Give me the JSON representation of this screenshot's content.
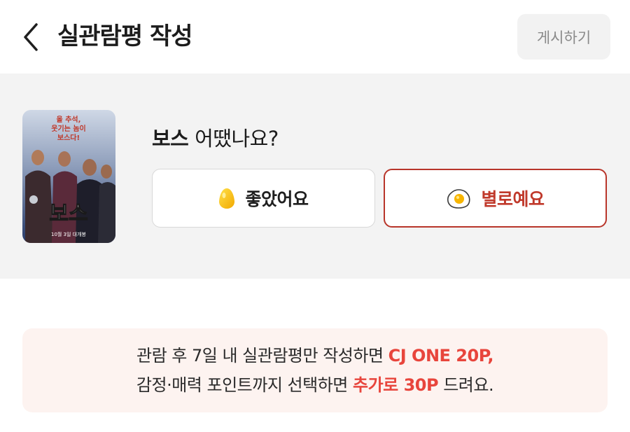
{
  "header": {
    "title": "실관람평 작성",
    "post_label": "게시하기"
  },
  "movie": {
    "title": "보스",
    "question_suffix": " 어땠나요?",
    "poster": {
      "tagline_line1": "올 추석,",
      "tagline_line2": "웃기는 놈이",
      "tagline_line3": "보스다!",
      "title": "보스",
      "release": "10월 3일 대개봉"
    }
  },
  "choices": {
    "good_label": "좋았어요",
    "bad_label": "별로예요",
    "selected": "bad"
  },
  "info": {
    "line1_text": "관람 후 7일 내 실관람평만 작성하면 ",
    "line1_highlight": "CJ ONE 20P,",
    "line2_text": "감정·매력 포인트까지 선택하면 ",
    "line2_highlight": "추가로 30P",
    "line2_suffix": " 드려요."
  },
  "colors": {
    "accent_red": "#e8453c",
    "selected_border": "#b8352a",
    "info_bg": "#fdf3f0",
    "section_bg": "#f3f3f3"
  }
}
